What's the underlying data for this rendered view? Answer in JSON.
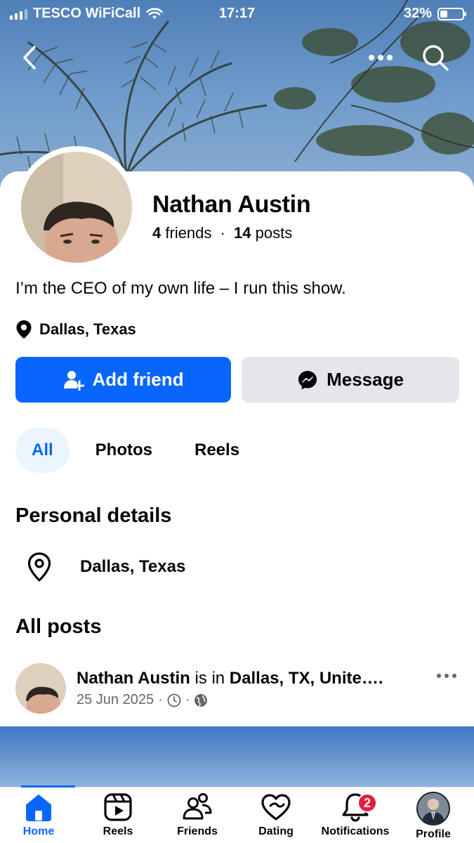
{
  "status_bar": {
    "carrier": "TESCO WiFiCall",
    "time": "17:17",
    "battery_percent": "32%",
    "battery_level": 0.32
  },
  "top_bar": {
    "back_icon": "chevron-left-icon",
    "more_icon": "more-horizontal-icon",
    "search_icon": "search-icon"
  },
  "profile": {
    "name": "Nathan Austin",
    "friends_count": "4",
    "friends_label": "friends",
    "posts_count": "14",
    "posts_label": "posts",
    "bio": "I’m the CEO of my own life – I run this show.",
    "location": "Dallas, Texas"
  },
  "actions": {
    "add_friend_label": "Add friend",
    "message_label": "Message"
  },
  "tabs": [
    {
      "label": "All",
      "active": true
    },
    {
      "label": "Photos",
      "active": false
    },
    {
      "label": "Reels",
      "active": false
    }
  ],
  "personal_details": {
    "heading": "Personal details",
    "location": "Dallas, Texas"
  },
  "posts": {
    "heading": "All posts",
    "first": {
      "author": "Nathan Austin",
      "connector": " is in ",
      "place": "Dallas, TX, Unite….",
      "date": "25 Jun 2025",
      "separator": "·"
    }
  },
  "bottom_nav": [
    {
      "label": "Home",
      "icon": "home-icon",
      "active": true
    },
    {
      "label": "Reels",
      "icon": "reels-icon",
      "active": false
    },
    {
      "label": "Friends",
      "icon": "friends-icon",
      "active": false
    },
    {
      "label": "Dating",
      "icon": "dating-heart-icon",
      "active": false
    },
    {
      "label": "Notifications",
      "icon": "bell-icon",
      "active": false,
      "badge": "2"
    },
    {
      "label": "Profile",
      "icon": "profile-avatar",
      "active": false
    }
  ],
  "colors": {
    "accent": "#0866ff",
    "secondary_button": "#e4e6eb",
    "active_tab_bg": "#ebf5ff",
    "badge": "#e41e3f"
  }
}
